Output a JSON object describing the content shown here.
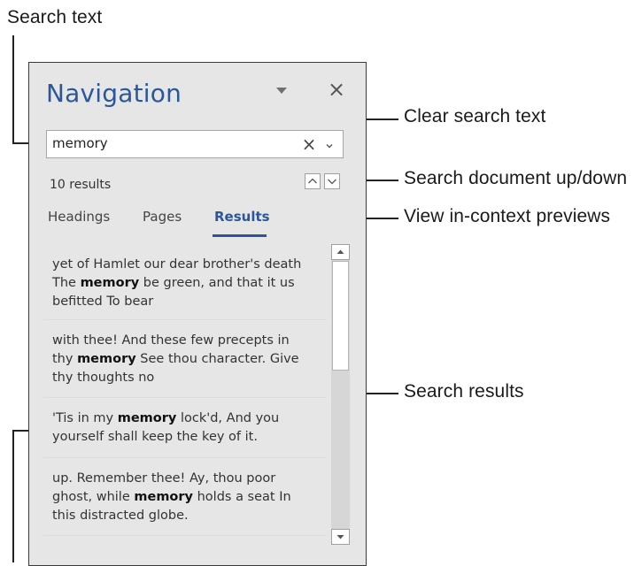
{
  "callouts": {
    "search_text": "Search text",
    "clear_search_text": "Clear search text",
    "search_up_down": "Search document up/down",
    "in_context_previews": "View in-context previews",
    "search_results": "Search results"
  },
  "panel": {
    "title": "Navigation",
    "close_glyph": "×",
    "menu_icon": "chevron-down-icon",
    "search": {
      "value": "memory",
      "clear_glyph": "×"
    },
    "results_count": "10 results",
    "tabs": [
      {
        "label": "Headings",
        "active": false
      },
      {
        "label": "Pages",
        "active": false
      },
      {
        "label": "Results",
        "active": true
      }
    ],
    "results": [
      {
        "lines": [
          {
            "before": "yet of Hamlet our dear brother's death",
            "bold": "",
            "after": ""
          },
          {
            "before": "The ",
            "bold": "memory",
            "after": " be green, and that it us"
          },
          {
            "before": "befitted To bear",
            "bold": "",
            "after": ""
          }
        ]
      },
      {
        "lines": [
          {
            "before": "with thee! And these few precepts in",
            "bold": "",
            "after": ""
          },
          {
            "before": "thy ",
            "bold": "memory",
            "after": " See thou character. Give"
          },
          {
            "before": "thy thoughts no",
            "bold": "",
            "after": ""
          }
        ]
      },
      {
        "lines": [
          {
            "before": "'Tis in my ",
            "bold": "memory",
            "after": " lock'd, And you"
          },
          {
            "before": "yourself shall keep the key of it.",
            "bold": "",
            "after": ""
          }
        ]
      },
      {
        "lines": [
          {
            "before": "up. Remember thee! Ay, thou poor",
            "bold": "",
            "after": ""
          },
          {
            "before": "ghost, while ",
            "bold": "memory",
            "after": " holds a seat In"
          },
          {
            "before": "this distracted globe.",
            "bold": "",
            "after": ""
          }
        ]
      }
    ]
  },
  "colors": {
    "accent": "#2b579a",
    "panel_bg": "#e6e6e6"
  }
}
